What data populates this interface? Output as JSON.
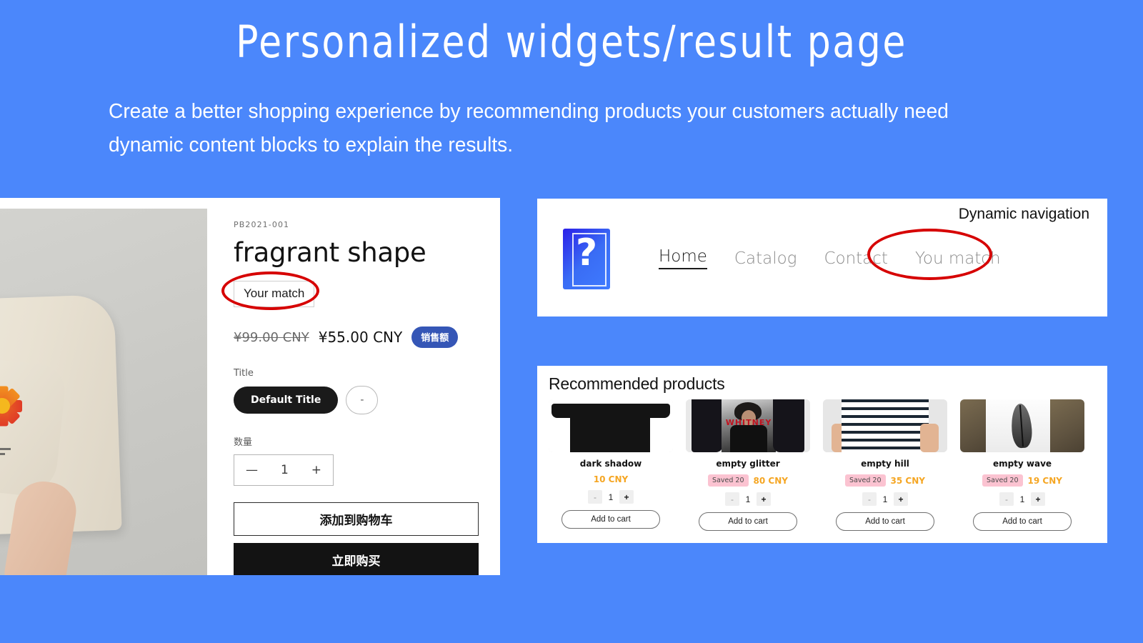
{
  "header": {
    "title": "Personalized widgets/result page",
    "subtitle": "Create a better shopping experience by recommending products your customers actually need dynamic content blocks to explain the results."
  },
  "product_detail": {
    "sku": "PB2021-001",
    "title": "fragrant shape",
    "match_badge": "Your match",
    "price_compare": "¥99.00 CNY",
    "price_current": "¥55.00 CNY",
    "sale_badge": "销售额",
    "variant_label": "Title",
    "variant_options": [
      "Default Title",
      "-"
    ],
    "quantity_label": "数量",
    "quantity_minus": "—",
    "quantity_value": "1",
    "quantity_plus": "+",
    "add_to_cart": "添加到购物车",
    "buy_now": "立即购买"
  },
  "navigation": {
    "note": "Dynamic navigation",
    "logo_glyph": "?",
    "links": [
      {
        "label": "Home",
        "active": true
      },
      {
        "label": "Catalog",
        "active": false
      },
      {
        "label": "Contact",
        "active": false
      },
      {
        "label": "You match",
        "active": false
      }
    ]
  },
  "recommendations": {
    "title": "Recommended products",
    "add_to_cart_label": "Add to cart",
    "stepper_minus": "-",
    "stepper_plus": "+",
    "items": [
      {
        "name": "dark shadow",
        "saved": "",
        "price": "10 CNY",
        "qty": "1"
      },
      {
        "name": "empty glitter",
        "saved": "Saved 20",
        "price": "80 CNY",
        "qty": "1"
      },
      {
        "name": "empty hill",
        "saved": "Saved 20",
        "price": "35 CNY",
        "qty": "1"
      },
      {
        "name": "empty wave",
        "saved": "Saved 20",
        "price": "19 CNY",
        "qty": "1"
      }
    ]
  },
  "thumb_overlay": {
    "whitney": "WHITNEY"
  },
  "colors": {
    "background": "#4b87fb",
    "sale_badge": "#3556b6",
    "price_accent": "#f5a623",
    "saved_badge": "#fbc3d1",
    "annotation": "#d60000"
  }
}
